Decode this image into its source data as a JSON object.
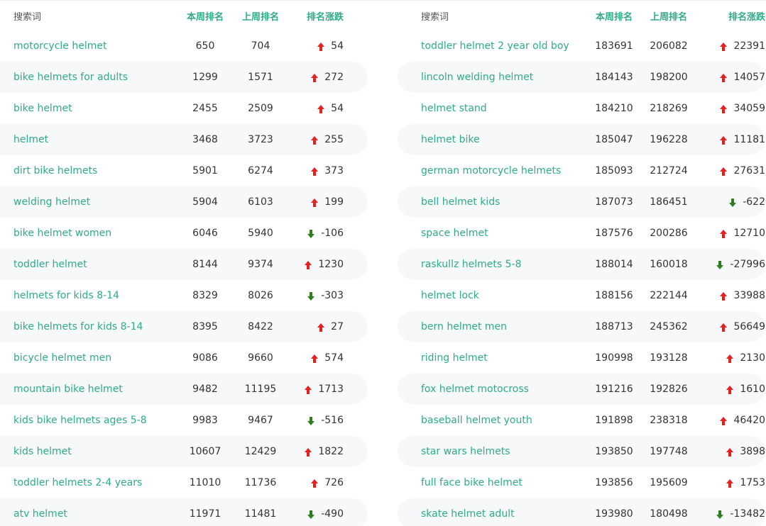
{
  "headers": {
    "term": "搜索词",
    "this_week": "本周排名",
    "last_week": "上周排名",
    "change": "排名涨跌"
  },
  "colors": {
    "term_green": "#2eab8a",
    "up_red": "#e8201c",
    "down_green": "#2f7d1e",
    "row_alt_bg": "#f7f8f9"
  },
  "left_rows": [
    {
      "term": "motorcycle helmet",
      "this_week": "650",
      "last_week": "704",
      "direction": "up",
      "change": "54"
    },
    {
      "term": "bike helmets for adults",
      "this_week": "1299",
      "last_week": "1571",
      "direction": "up",
      "change": "272"
    },
    {
      "term": "bike helmet",
      "this_week": "2455",
      "last_week": "2509",
      "direction": "up",
      "change": "54"
    },
    {
      "term": "helmet",
      "this_week": "3468",
      "last_week": "3723",
      "direction": "up",
      "change": "255"
    },
    {
      "term": "dirt bike helmets",
      "this_week": "5901",
      "last_week": "6274",
      "direction": "up",
      "change": "373"
    },
    {
      "term": "welding helmet",
      "this_week": "5904",
      "last_week": "6103",
      "direction": "up",
      "change": "199"
    },
    {
      "term": "bike helmet women",
      "this_week": "6046",
      "last_week": "5940",
      "direction": "down",
      "change": "-106"
    },
    {
      "term": "toddler helmet",
      "this_week": "8144",
      "last_week": "9374",
      "direction": "up",
      "change": "1230"
    },
    {
      "term": "helmets for kids 8-14",
      "this_week": "8329",
      "last_week": "8026",
      "direction": "down",
      "change": "-303"
    },
    {
      "term": "bike helmets for kids 8-14",
      "this_week": "8395",
      "last_week": "8422",
      "direction": "up",
      "change": "27"
    },
    {
      "term": "bicycle helmet men",
      "this_week": "9086",
      "last_week": "9660",
      "direction": "up",
      "change": "574"
    },
    {
      "term": "mountain bike helmet",
      "this_week": "9482",
      "last_week": "11195",
      "direction": "up",
      "change": "1713"
    },
    {
      "term": "kids bike helmets ages 5-8",
      "this_week": "9983",
      "last_week": "9467",
      "direction": "down",
      "change": "-516"
    },
    {
      "term": "kids helmet",
      "this_week": "10607",
      "last_week": "12429",
      "direction": "up",
      "change": "1822"
    },
    {
      "term": "toddler helmets 2-4 years",
      "this_week": "11010",
      "last_week": "11736",
      "direction": "up",
      "change": "726"
    },
    {
      "term": "atv helmet",
      "this_week": "11971",
      "last_week": "11481",
      "direction": "down",
      "change": "-490"
    }
  ],
  "right_rows": [
    {
      "term": "toddler helmet 2 year old boy",
      "this_week": "183691",
      "last_week": "206082",
      "direction": "up",
      "change": "22391"
    },
    {
      "term": "lincoln welding helmet",
      "this_week": "184143",
      "last_week": "198200",
      "direction": "up",
      "change": "14057"
    },
    {
      "term": "helmet stand",
      "this_week": "184210",
      "last_week": "218269",
      "direction": "up",
      "change": "34059"
    },
    {
      "term": "helmet bike",
      "this_week": "185047",
      "last_week": "196228",
      "direction": "up",
      "change": "11181"
    },
    {
      "term": "german motorcycle helmets",
      "this_week": "185093",
      "last_week": "212724",
      "direction": "up",
      "change": "27631"
    },
    {
      "term": "bell helmet kids",
      "this_week": "187073",
      "last_week": "186451",
      "direction": "down",
      "change": "-622"
    },
    {
      "term": "space helmet",
      "this_week": "187576",
      "last_week": "200286",
      "direction": "up",
      "change": "12710"
    },
    {
      "term": "raskullz helmets 5-8",
      "this_week": "188014",
      "last_week": "160018",
      "direction": "down",
      "change": "-27996"
    },
    {
      "term": "helmet lock",
      "this_week": "188156",
      "last_week": "222144",
      "direction": "up",
      "change": "33988"
    },
    {
      "term": "bern helmet men",
      "this_week": "188713",
      "last_week": "245362",
      "direction": "up",
      "change": "56649"
    },
    {
      "term": "riding helmet",
      "this_week": "190998",
      "last_week": "193128",
      "direction": "up",
      "change": "2130"
    },
    {
      "term": "fox helmet motocross",
      "this_week": "191216",
      "last_week": "192826",
      "direction": "up",
      "change": "1610"
    },
    {
      "term": "baseball helmet youth",
      "this_week": "191898",
      "last_week": "238318",
      "direction": "up",
      "change": "46420"
    },
    {
      "term": "star wars helmets",
      "this_week": "193850",
      "last_week": "197748",
      "direction": "up",
      "change": "3898"
    },
    {
      "term": "full face bike helmet",
      "this_week": "193856",
      "last_week": "195609",
      "direction": "up",
      "change": "1753"
    },
    {
      "term": "skate helmet adult",
      "this_week": "193980",
      "last_week": "180498",
      "direction": "down",
      "change": "-13482"
    }
  ]
}
